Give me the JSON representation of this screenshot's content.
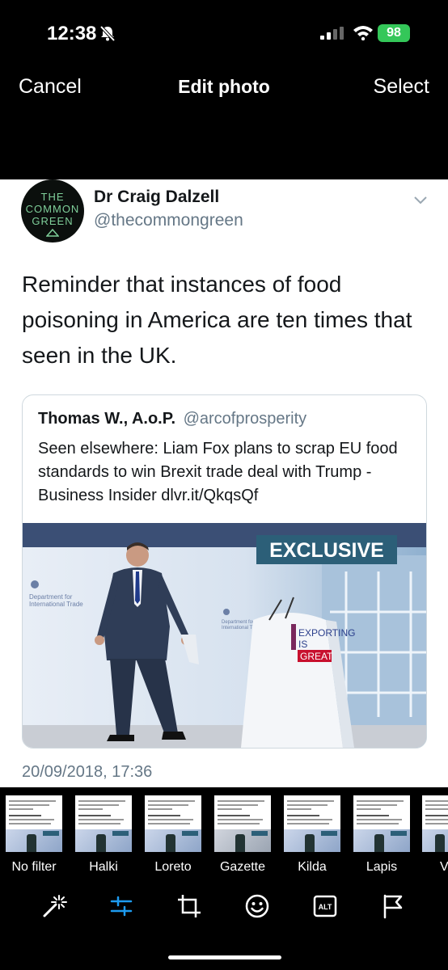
{
  "status_bar": {
    "time": "12:38",
    "battery": "98"
  },
  "nav": {
    "cancel": "Cancel",
    "title": "Edit photo",
    "select": "Select"
  },
  "tweet": {
    "avatar_lines": [
      "THE",
      "COMMON",
      "GREEN"
    ],
    "author": "Dr Craig Dalzell",
    "handle": "@thecommongreen",
    "text": "Reminder that instances of food poisoning in America are ten times that seen in the UK.",
    "quote": {
      "author": "Thomas W., A.o.P.",
      "handle": "@arcofprosperity",
      "text": "Seen elsewhere: Liam Fox plans to scrap EU food standards to win Brexit trade deal with Trump - Business Insider dlvr.it/QkqsQf",
      "image": {
        "badge": "EXCLUSIVE",
        "podium": [
          "EXPORTING",
          "IS",
          "GREAT"
        ],
        "backdrop": [
          "Department for",
          "International Trade"
        ]
      }
    },
    "timestamp": "20/09/2018, 17:36"
  },
  "filters": [
    "No filter",
    "Halki",
    "Loreto",
    "Gazette",
    "Kilda",
    "Lapis",
    "V"
  ],
  "toolbar": {
    "icons": [
      "magic-wand-icon",
      "adjust-sliders-icon",
      "crop-icon",
      "sticker-icon",
      "alt-text-icon",
      "flag-icon"
    ],
    "alt_label": "ALT",
    "active_color": "#1d9bf0"
  }
}
